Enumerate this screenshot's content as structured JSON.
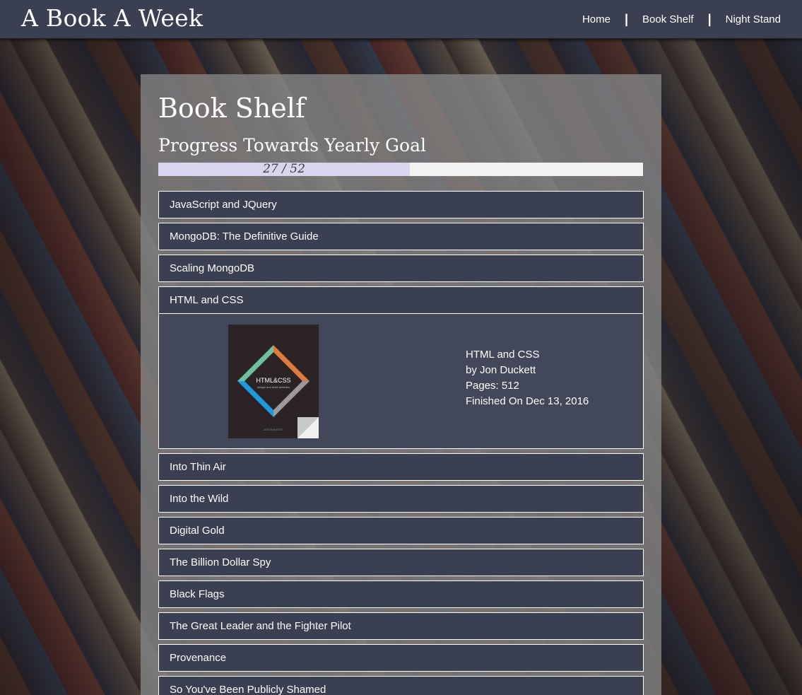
{
  "brand": "A Book A Week",
  "nav": [
    {
      "label": "Home"
    },
    {
      "label": "Book Shelf"
    },
    {
      "label": "Night Stand"
    }
  ],
  "nav_separator": "|",
  "page": {
    "title": "Book Shelf",
    "goal_title": "Progress Towards Yearly Goal",
    "progress": {
      "read": 27,
      "goal": 52,
      "text": "27 / 52"
    }
  },
  "books": [
    {
      "title": "JavaScript and JQuery"
    },
    {
      "title": "MongoDB: The Definitive Guide"
    },
    {
      "title": "Scaling MongoDB"
    },
    {
      "title": "HTML and CSS",
      "expanded": true,
      "details": {
        "title": "HTML and CSS",
        "author_line": "by Jon Duckett",
        "pages_line": "Pages: 512",
        "finished_line": "Finished On Dec 13, 2016",
        "cover_title": "HTML&CSS",
        "cover_subtitle": "design and build websites",
        "cover_author": "JON DUCKETT"
      }
    },
    {
      "title": "Into Thin Air"
    },
    {
      "title": "Into the Wild"
    },
    {
      "title": "Digital Gold"
    },
    {
      "title": "The Billion Dollar Spy"
    },
    {
      "title": "Black Flags"
    },
    {
      "title": "The Great Leader and the Fighter Pilot"
    },
    {
      "title": "Provenance"
    },
    {
      "title": "So You've Been Publicly Shamed"
    }
  ],
  "colors": {
    "navbar": "#3a4052",
    "item_bg": "#3a4052",
    "panel": "#828282",
    "progress_fill": "#d8d5ee",
    "progress_track": "#f2f2f2"
  },
  "icons": {
    "cover_image": "html-css-book-cover"
  }
}
